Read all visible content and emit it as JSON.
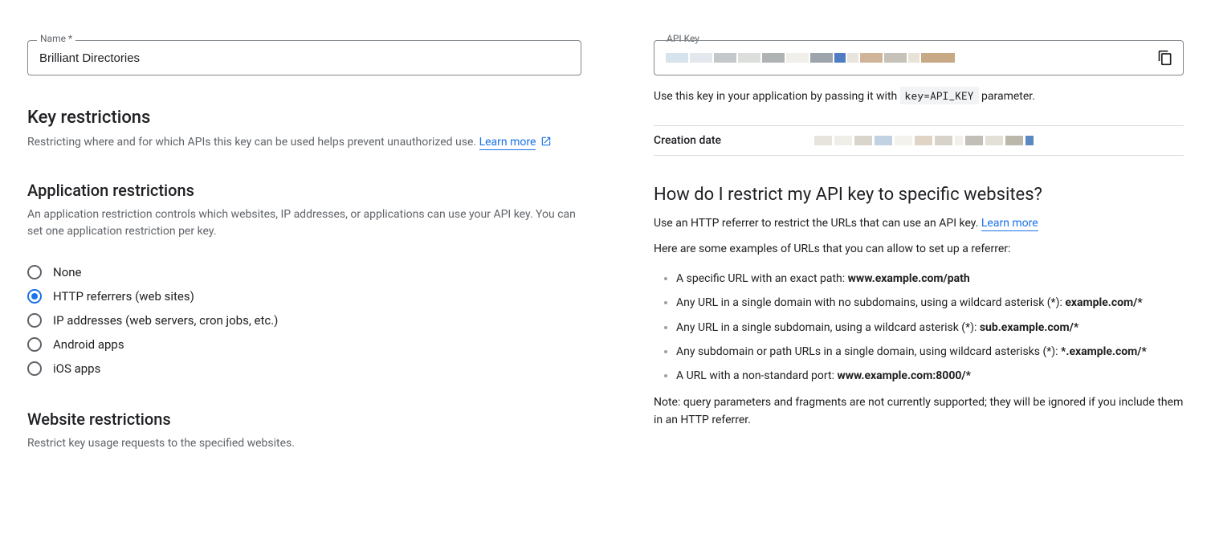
{
  "left": {
    "name_field": {
      "label": "Name *",
      "value": "Brilliant Directories"
    },
    "key_restrictions": {
      "heading": "Key restrictions",
      "desc": "Restricting where and for which APIs this key can be used helps prevent unauthorized use.",
      "learn_more": "Learn more"
    },
    "app_restrictions": {
      "heading": "Application restrictions",
      "desc": "An application restriction controls which websites, IP addresses, or applications can use your API key. You can set one application restriction per key.",
      "options": [
        "None",
        "HTTP referrers (web sites)",
        "IP addresses (web servers, cron jobs, etc.)",
        "Android apps",
        "iOS apps"
      ],
      "selected_index": 1
    },
    "website_restrictions": {
      "heading": "Website restrictions",
      "desc": "Restrict key usage requests to the specified websites."
    }
  },
  "right": {
    "api_key_label": "API Key",
    "key_hint_pre": "Use this key in your application by passing it with ",
    "key_hint_code": "key=API_KEY",
    "key_hint_post": " parameter.",
    "creation_date_label": "Creation date",
    "help_heading": "How do I restrict my API key to specific websites?",
    "help_intro": "Use an HTTP referrer to restrict the URLs that can use an API key.",
    "help_learn_more": "Learn more",
    "examples_intro": "Here are some examples of URLs that you can allow to set up a referrer:",
    "examples": [
      {
        "text": "A specific URL with an exact path: ",
        "bold": "www.example.com/path"
      },
      {
        "text": "Any URL in a single domain with no subdomains, using a wildcard asterisk (*): ",
        "bold": "example.com/*"
      },
      {
        "text": "Any URL in a single subdomain, using a wildcard asterisk (*): ",
        "bold": "sub.example.com/*"
      },
      {
        "text": "Any subdomain or path URLs in a single domain, using wildcard asterisks (*): ",
        "bold": "*.example.com/*"
      },
      {
        "text": "A URL with a non-standard port: ",
        "bold": "www.example.com:8000/*"
      }
    ],
    "note": "Note: query parameters and fragments are not currently supported; they will be ignored if you include them in an HTTP referrer."
  },
  "redaction_palette": {
    "key": [
      {
        "w": 28,
        "c": "#d7e3ed"
      },
      {
        "w": 28,
        "c": "#e3e8ee"
      },
      {
        "w": 28,
        "c": "#c4c8cb"
      },
      {
        "w": 28,
        "c": "#dcdedc"
      },
      {
        "w": 28,
        "c": "#afb3b4"
      },
      {
        "w": 28,
        "c": "#f1efe9"
      },
      {
        "w": 28,
        "c": "#9da4ac"
      },
      {
        "w": 14,
        "c": "#4f7cc3"
      },
      {
        "w": 14,
        "c": "#e8e4de"
      },
      {
        "w": 28,
        "c": "#d0b49a"
      },
      {
        "w": 28,
        "c": "#c6c1b9"
      },
      {
        "w": 14,
        "c": "#e7e3d9"
      },
      {
        "w": 42,
        "c": "#c7a986"
      }
    ],
    "date": [
      {
        "w": 22,
        "c": "#e7e4de"
      },
      {
        "w": 22,
        "c": "#f0eee9"
      },
      {
        "w": 22,
        "c": "#d9d5cc"
      },
      {
        "w": 22,
        "c": "#c2d2e2"
      },
      {
        "w": 22,
        "c": "#f4f2ed"
      },
      {
        "w": 22,
        "c": "#e0d4c5"
      },
      {
        "w": 22,
        "c": "#d8d3ca"
      },
      {
        "w": 10,
        "c": "#f2f0eb"
      },
      {
        "w": 22,
        "c": "#c2bfb8"
      },
      {
        "w": 22,
        "c": "#e3e0d8"
      },
      {
        "w": 22,
        "c": "#bcb7ab"
      },
      {
        "w": 10,
        "c": "#5a88c0"
      }
    ]
  }
}
